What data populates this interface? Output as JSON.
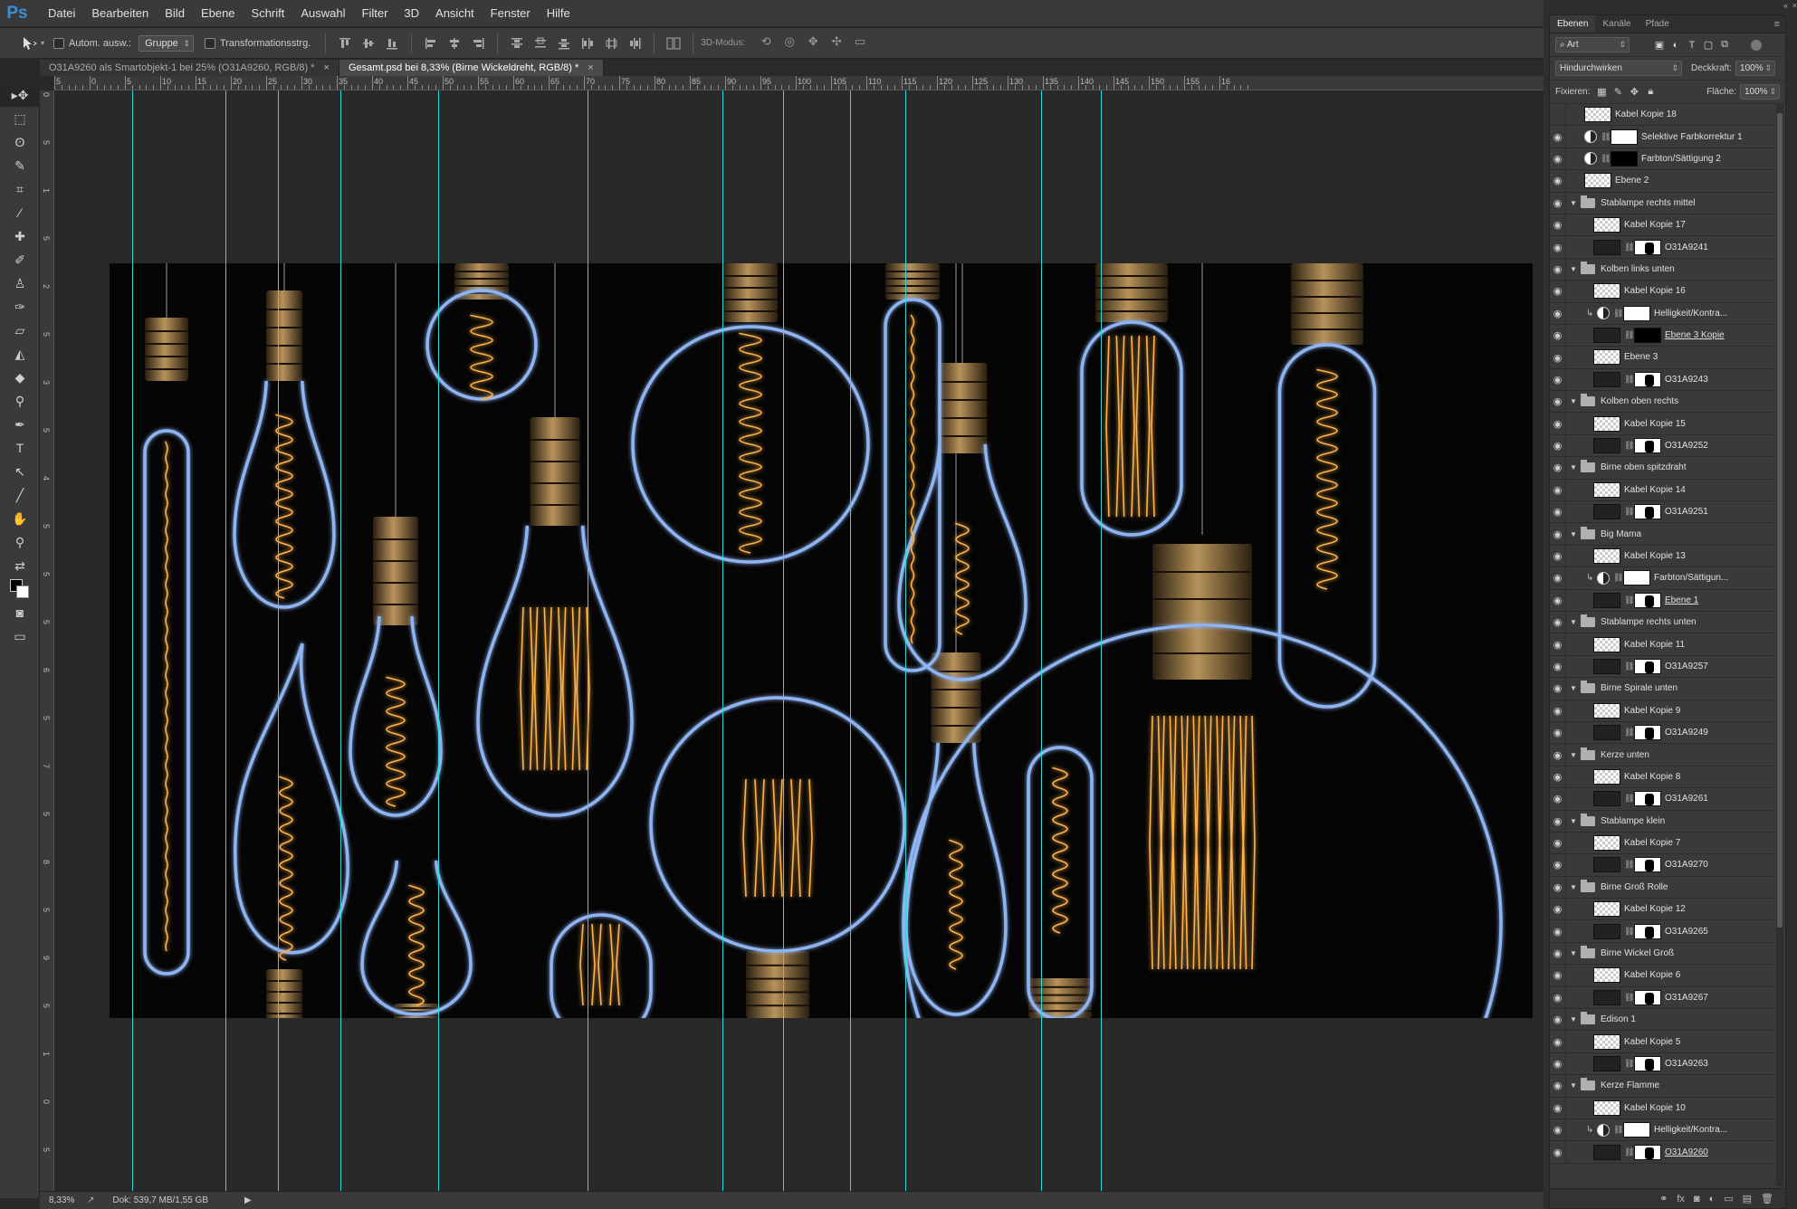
{
  "app": {
    "logo": "Ps"
  },
  "menu": [
    "Datei",
    "Bearbeiten",
    "Bild",
    "Ebene",
    "Schrift",
    "Auswahl",
    "Filter",
    "3D",
    "Ansicht",
    "Fenster",
    "Hilfe"
  ],
  "options": {
    "auto_select_label": "Autom. ausw.:",
    "auto_select_value": "Gruppe",
    "transform_label": "Transformationsstrg.",
    "mode3d_label": "3D-Modus:"
  },
  "tabs": [
    {
      "label": "O31A9260 als Smartobjekt-1 bei 25% (O31A9260, RGB/8) *",
      "active": false
    },
    {
      "label": "Gesamt.psd bei 8,33% (Birne Wickeldreht, RGB/8) *",
      "active": true
    }
  ],
  "ruler_top": [
    "5",
    "0",
    "5",
    "10",
    "15",
    "20",
    "25",
    "30",
    "35",
    "40",
    "45",
    "50",
    "55",
    "60",
    "65",
    "70",
    "75",
    "80",
    "85",
    "90",
    "95",
    "100",
    "105",
    "110",
    "115",
    "120",
    "125",
    "130",
    "135",
    "140",
    "145",
    "150",
    "155",
    "16"
  ],
  "ruler_left": [
    "0",
    "5",
    "1",
    "5",
    "2",
    "5",
    "3",
    "5",
    "4",
    "5",
    "5",
    "5",
    "6",
    "5",
    "7",
    "5",
    "8",
    "5",
    "9",
    "5",
    "1",
    "0",
    "5"
  ],
  "status": {
    "zoom": "8,33%",
    "doc": "Dok: 539,7 MB/1,55 GB"
  },
  "panel": {
    "tabs": [
      "Ebenen",
      "Kanäle",
      "Pfade"
    ],
    "filter_kind": "Art",
    "blend_mode": "Hindurchwirken",
    "opacity_label": "Deckkraft:",
    "opacity_value": "100%",
    "lock_label": "Fixieren:",
    "fill_label": "Fläche:",
    "fill_value": "100%"
  },
  "layers": [
    {
      "type": "layer",
      "name": "Kabel Kopie 18",
      "visible": false,
      "indent": 1
    },
    {
      "type": "adj",
      "name": "Selektive Farbkorrektur 1",
      "visible": true,
      "indent": 1,
      "mask": "white"
    },
    {
      "type": "adj",
      "name": "Farbton/Sättigung 2",
      "visible": true,
      "indent": 1,
      "mask": "black"
    },
    {
      "type": "layer",
      "name": "Ebene 2",
      "visible": true,
      "indent": 1
    },
    {
      "type": "group",
      "name": "Stablampe rechts mittel",
      "visible": true
    },
    {
      "type": "layer",
      "name": "Kabel Kopie 17",
      "visible": true,
      "indent": 2
    },
    {
      "type": "smart",
      "name": "O31A9241",
      "visible": true,
      "indent": 2
    },
    {
      "type": "group",
      "name": "Kolben links unten",
      "visible": true
    },
    {
      "type": "layer",
      "name": "Kabel Kopie 16",
      "visible": true,
      "indent": 2
    },
    {
      "type": "clipadj",
      "name": "Helligkeit/Kontra...",
      "visible": true,
      "indent": 2,
      "mask": "white"
    },
    {
      "type": "masked",
      "name": "Ebene 3 Kopie",
      "visible": true,
      "indent": 2,
      "u": true
    },
    {
      "type": "layer",
      "name": "Ebene 3",
      "visible": true,
      "indent": 2
    },
    {
      "type": "smart",
      "name": "O31A9243",
      "visible": true,
      "indent": 2
    },
    {
      "type": "group",
      "name": "Kolben oben rechts",
      "visible": true
    },
    {
      "type": "layer",
      "name": "Kabel Kopie 15",
      "visible": true,
      "indent": 2
    },
    {
      "type": "smart",
      "name": "O31A9252",
      "visible": true,
      "indent": 2
    },
    {
      "type": "group",
      "name": "Birne oben spitzdraht",
      "visible": true
    },
    {
      "type": "layer",
      "name": "Kabel Kopie 14",
      "visible": true,
      "indent": 2
    },
    {
      "type": "smart",
      "name": "O31A9251",
      "visible": true,
      "indent": 2
    },
    {
      "type": "group",
      "name": "Big Mama",
      "visible": true
    },
    {
      "type": "layer",
      "name": "Kabel Kopie 13",
      "visible": true,
      "indent": 2
    },
    {
      "type": "clipadj",
      "name": "Farbton/Sättigun...",
      "visible": true,
      "indent": 2,
      "mask": "white"
    },
    {
      "type": "smart",
      "name": "Ebene 1",
      "visible": true,
      "indent": 2,
      "u": true
    },
    {
      "type": "group",
      "name": "Stablampe rechts unten",
      "visible": true
    },
    {
      "type": "layer",
      "name": "Kabel Kopie 11",
      "visible": true,
      "indent": 2
    },
    {
      "type": "smart",
      "name": "O31A9257",
      "visible": true,
      "indent": 2
    },
    {
      "type": "group",
      "name": "Birne Spirale unten",
      "visible": true
    },
    {
      "type": "layer",
      "name": "Kabel Kopie 9",
      "visible": true,
      "indent": 2
    },
    {
      "type": "smart",
      "name": "O31A9249",
      "visible": true,
      "indent": 2
    },
    {
      "type": "group",
      "name": "Kerze unten",
      "visible": true
    },
    {
      "type": "layer",
      "name": "Kabel Kopie 8",
      "visible": true,
      "indent": 2
    },
    {
      "type": "smart",
      "name": "O31A9261",
      "visible": true,
      "indent": 2
    },
    {
      "type": "group",
      "name": "Stablampe klein",
      "visible": true
    },
    {
      "type": "layer",
      "name": "Kabel Kopie 7",
      "visible": true,
      "indent": 2
    },
    {
      "type": "smart",
      "name": "O31A9270",
      "visible": true,
      "indent": 2
    },
    {
      "type": "group",
      "name": "Birne Groß Rolle",
      "visible": true
    },
    {
      "type": "layer",
      "name": "Kabel Kopie 12",
      "visible": true,
      "indent": 2
    },
    {
      "type": "smart",
      "name": "O31A9265",
      "visible": true,
      "indent": 2
    },
    {
      "type": "group",
      "name": "Birne Wickel Groß",
      "visible": true
    },
    {
      "type": "layer",
      "name": "Kabel Kopie 6",
      "visible": true,
      "indent": 2
    },
    {
      "type": "smart",
      "name": "O31A9267",
      "visible": true,
      "indent": 2
    },
    {
      "type": "group",
      "name": "Edison 1",
      "visible": true
    },
    {
      "type": "layer",
      "name": "Kabel Kopie 5",
      "visible": true,
      "indent": 2
    },
    {
      "type": "smart",
      "name": "O31A9263",
      "visible": true,
      "indent": 2
    },
    {
      "type": "group",
      "name": "Kerze Flamme",
      "visible": true
    },
    {
      "type": "layer",
      "name": "Kabel Kopie 10",
      "visible": true,
      "indent": 2
    },
    {
      "type": "clipadj",
      "name": "Helligkeit/Kontra...",
      "visible": true,
      "indent": 2,
      "mask": "white"
    },
    {
      "type": "smart",
      "name": "O31A9260",
      "visible": true,
      "indent": 2,
      "u": true
    }
  ],
  "colors": {
    "guide": "#35d6d6",
    "accent": "#3b8fd9",
    "filament": "#ffb24a",
    "glass": "#9fc2ff"
  }
}
